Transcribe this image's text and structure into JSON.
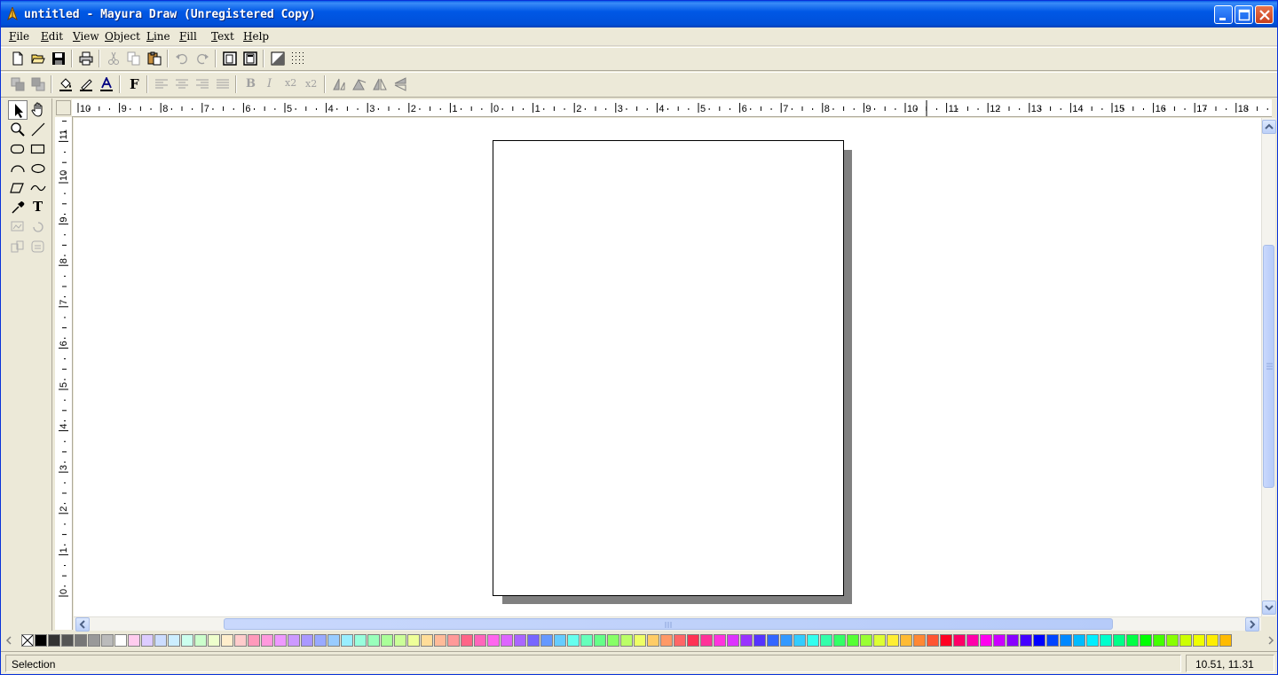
{
  "window": {
    "title": "untitled - Mayura Draw (Unregistered Copy)"
  },
  "menu": [
    "File",
    "Edit",
    "View",
    "Object",
    "Line",
    "Fill",
    "Text",
    "Help"
  ],
  "toolbar1": {
    "icons": [
      "new-icon",
      "open-icon",
      "save-icon",
      "print-icon",
      "cut-icon",
      "copy-icon",
      "paste-icon",
      "undo-icon",
      "redo-icon",
      "page-setup-icon",
      "page-view-icon",
      "fill-gradient-icon",
      "grid-icon"
    ]
  },
  "toolbar2": {
    "font_button": "F",
    "bold_button": "B",
    "italic_button": "I",
    "superscript_button": "x2",
    "subscript_button": "x2",
    "icons": [
      "bring-forward-icon",
      "send-backward-icon",
      "fill-color-icon",
      "line-color-icon",
      "text-color-icon",
      "align-left-icon",
      "align-center-icon",
      "align-right-icon",
      "justify-icon",
      "rotate-left-icon",
      "rotate-right-icon",
      "flip-horizontal-icon",
      "flip-vertical-icon"
    ]
  },
  "tools": {
    "text_tool": "T",
    "icons": [
      "select-arrow-icon",
      "hand-pan-icon",
      "zoom-icon",
      "line-icon",
      "rounded-rect-icon",
      "rectangle-icon",
      "arc-icon",
      "ellipse-icon",
      "polygon-icon",
      "curve-icon",
      "eyedropper-icon",
      "text-icon",
      "image-icon",
      "rotate-icon",
      "group-icon",
      "ungroup-icon"
    ]
  },
  "rulers": {
    "horizontal_labels": [
      "10",
      "9",
      "8",
      "7",
      "6",
      "5",
      "4",
      "3",
      "2",
      "1",
      "0",
      "1",
      "2",
      "3",
      "4",
      "5",
      "6",
      "7",
      "8",
      "9",
      "10",
      "11",
      "12",
      "13",
      "14",
      "15",
      "16",
      "17",
      "18"
    ],
    "vertical_labels": [
      "11",
      "10",
      "9",
      "8",
      "7",
      "6",
      "5",
      "4",
      "3",
      "2",
      "1",
      "0"
    ]
  },
  "palette": {
    "colors": [
      "#000000",
      "#333333",
      "#555555",
      "#777777",
      "#999999",
      "#bbbbbb",
      "#ffffff",
      "#ffccee",
      "#ddccff",
      "#ccddff",
      "#cceeff",
      "#ccffee",
      "#ccffcc",
      "#eeffcc",
      "#ffeecc",
      "#ffcccc",
      "#ff99bb",
      "#ff99dd",
      "#ee99ff",
      "#cc99ff",
      "#aa99ff",
      "#99aaff",
      "#99ccff",
      "#99eeff",
      "#99ffdd",
      "#99ffbb",
      "#aaff99",
      "#ccff99",
      "#eeff99",
      "#ffdd99",
      "#ffbb99",
      "#ff9999",
      "#ff6688",
      "#ff66bb",
      "#ff66ee",
      "#dd66ff",
      "#aa66ff",
      "#7766ff",
      "#6699ff",
      "#66ccff",
      "#66ffee",
      "#66ffbb",
      "#66ff88",
      "#88ff66",
      "#bbff66",
      "#eeff66",
      "#ffcc66",
      "#ff9966",
      "#ff6666",
      "#ff3355",
      "#ff3399",
      "#ff33dd",
      "#dd33ff",
      "#9933ff",
      "#5533ff",
      "#3366ff",
      "#3399ff",
      "#33ccff",
      "#33ffee",
      "#33ffaa",
      "#33ff66",
      "#55ff33",
      "#99ff33",
      "#ddff33",
      "#ffee33",
      "#ffbb33",
      "#ff8833",
      "#ff5533",
      "#ff0022",
      "#ff0066",
      "#ff00aa",
      "#ff00ee",
      "#cc00ff",
      "#8800ff",
      "#4400ff",
      "#0000ff",
      "#0044ff",
      "#0088ff",
      "#00bbff",
      "#00eeff",
      "#00ffcc",
      "#00ff88",
      "#00ff44",
      "#00ff00",
      "#44ff00",
      "#88ff00",
      "#ccff00",
      "#eeff00",
      "#ffee00",
      "#ffbb00"
    ]
  },
  "status": {
    "mode": "Selection",
    "coords": "10.51, 11.31"
  }
}
